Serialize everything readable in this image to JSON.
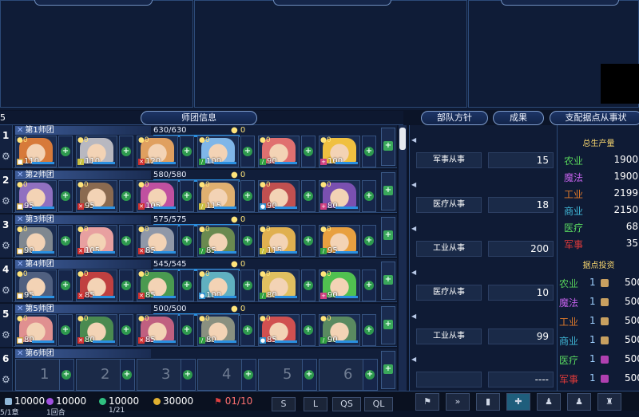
{
  "top_tabs": [
    "",
    "",
    ""
  ],
  "corner_label": "5",
  "headers": {
    "squad_info": "师团信息",
    "policy": "部队方针",
    "results": "成果",
    "stronghold": "支配据点从事状"
  },
  "squads": [
    {
      "num": "1",
      "name": "第1师团",
      "hp": "630/630",
      "gold": "0",
      "units": [
        {
          "lvl": "0",
          "hp": "110",
          "cls": "shield",
          "color": "#d77a3a"
        },
        {
          "lvl": "0",
          "hp": "110",
          "cls": "staff",
          "color": "#b8b8c0"
        },
        {
          "lvl": "0",
          "hp": "120",
          "cls": "sword",
          "color": "#e0a060"
        },
        {
          "lvl": "0",
          "hp": "100",
          "cls": "bow",
          "color": "#7fb6e8"
        },
        {
          "lvl": "0",
          "hp": "90",
          "cls": "bow",
          "color": "#e07070"
        },
        {
          "lvl": "0",
          "hp": "100",
          "cls": "heal",
          "color": "#f0c040"
        }
      ]
    },
    {
      "num": "2",
      "name": "第2师团",
      "hp": "580/580",
      "gold": "0",
      "units": [
        {
          "lvl": "0",
          "hp": "95",
          "cls": "shield",
          "color": "#9070c0"
        },
        {
          "lvl": "0",
          "hp": "95",
          "cls": "sword",
          "color": "#8a6a50"
        },
        {
          "lvl": "0",
          "hp": "105",
          "cls": "sword",
          "color": "#c050a0"
        },
        {
          "lvl": "0",
          "hp": "115",
          "cls": "staff",
          "color": "#e0b070"
        },
        {
          "lvl": "0",
          "hp": "90",
          "cls": "magic",
          "color": "#c05050"
        },
        {
          "lvl": "0",
          "hp": "80",
          "cls": "heal",
          "color": "#7a50b0"
        }
      ]
    },
    {
      "num": "3",
      "name": "第3师团",
      "hp": "575/575",
      "gold": "0",
      "units": [
        {
          "lvl": "0",
          "hp": "90",
          "cls": "shield",
          "color": "#808890"
        },
        {
          "lvl": "0",
          "hp": "105",
          "cls": "sword",
          "color": "#e8a0a0"
        },
        {
          "lvl": "0",
          "hp": "85",
          "cls": "sword",
          "color": "#9098a8"
        },
        {
          "lvl": "0",
          "hp": "85",
          "cls": "bow",
          "color": "#6a8a50"
        },
        {
          "lvl": "0",
          "hp": "115",
          "cls": "staff",
          "color": "#e0b050"
        },
        {
          "lvl": "0",
          "hp": "95",
          "cls": "bow",
          "color": "#e8a040"
        }
      ]
    },
    {
      "num": "4",
      "name": "第4师团",
      "hp": "545/545",
      "gold": "0",
      "units": [
        {
          "lvl": "0",
          "hp": "95",
          "cls": "shield",
          "color": "#506080"
        },
        {
          "lvl": "0",
          "hp": "85",
          "cls": "sword",
          "color": "#c04040"
        },
        {
          "lvl": "0",
          "hp": "85",
          "cls": "sword",
          "color": "#4a9a50"
        },
        {
          "lvl": "0",
          "hp": "100",
          "cls": "magic",
          "color": "#60b0c0"
        },
        {
          "lvl": "0",
          "hp": "80",
          "cls": "bow",
          "color": "#e0c060"
        },
        {
          "lvl": "0",
          "hp": "90",
          "cls": "heal",
          "color": "#50c050"
        }
      ]
    },
    {
      "num": "5",
      "name": "第5师团",
      "hp": "500/500",
      "gold": "0",
      "units": [
        {
          "lvl": "0",
          "hp": "80",
          "cls": "shield",
          "color": "#e09090"
        },
        {
          "lvl": "0",
          "hp": "80",
          "cls": "sword",
          "color": "#4a8a50"
        },
        {
          "lvl": "0",
          "hp": "85",
          "cls": "sword",
          "color": "#c06080"
        },
        {
          "lvl": "0",
          "hp": "80",
          "cls": "bow",
          "color": "#8a9080"
        },
        {
          "lvl": "0",
          "hp": "85",
          "cls": "magic",
          "color": "#d05050"
        },
        {
          "lvl": "0",
          "hp": "90",
          "cls": "bow",
          "color": "#5a8a60"
        }
      ]
    }
  ],
  "squad6": {
    "num": "6",
    "name": "第6师团",
    "slots": [
      "1",
      "2",
      "3",
      "4",
      "5",
      "6"
    ]
  },
  "policies": [
    {
      "name": "军事从事",
      "value": "15"
    },
    {
      "name": "医疗从事",
      "value": "18"
    },
    {
      "name": "工业从事",
      "value": "200"
    },
    {
      "name": "医疗从事",
      "value": "10"
    },
    {
      "name": "工业从事",
      "value": "99"
    },
    {
      "name": "",
      "value": "----"
    }
  ],
  "production": {
    "title": "总生产量",
    "rows": [
      {
        "label": "农业",
        "value": "1900",
        "color": "#56d05a"
      },
      {
        "label": "魔法",
        "value": "1900",
        "color": "#c060e8"
      },
      {
        "label": "工业",
        "value": "2199",
        "color": "#e07a2a"
      },
      {
        "label": "商业",
        "value": "2150",
        "color": "#40b8d8"
      },
      {
        "label": "医疗",
        "value": "68",
        "color": "#58d860"
      },
      {
        "label": "军事",
        "value": "35",
        "color": "#e03a3a"
      }
    ]
  },
  "investment": {
    "title": "据点投资",
    "rows": [
      {
        "label": "农业",
        "level": "1",
        "value": "500",
        "color": "#56d05a",
        "icon": "#c8a060"
      },
      {
        "label": "魔法",
        "level": "1",
        "value": "500",
        "color": "#c060e8",
        "icon": "#c8a060"
      },
      {
        "label": "工业",
        "level": "1",
        "value": "500",
        "color": "#e07a2a",
        "icon": "#c8a060"
      },
      {
        "label": "商业",
        "level": "1",
        "value": "500",
        "color": "#40b8d8",
        "icon": "#c8a060"
      },
      {
        "label": "医疗",
        "level": "1",
        "value": "500",
        "color": "#58d860",
        "icon": "#b040b0"
      },
      {
        "label": "军事",
        "level": "1",
        "value": "500",
        "color": "#e03a3a",
        "icon": "#b040b0"
      }
    ]
  },
  "resources": {
    "gold": "10000",
    "magic": "10000",
    "crystal": "10000",
    "money": "30000",
    "flags": "01/10",
    "sub1": "1回合",
    "sub2": "1/21",
    "sub0": "5/1章"
  },
  "bottom_buttons": [
    "S",
    "L",
    "QS",
    "QL"
  ],
  "tools": [
    "⚑",
    "»",
    "▮",
    "✚",
    "♟",
    "♟",
    "♜"
  ]
}
